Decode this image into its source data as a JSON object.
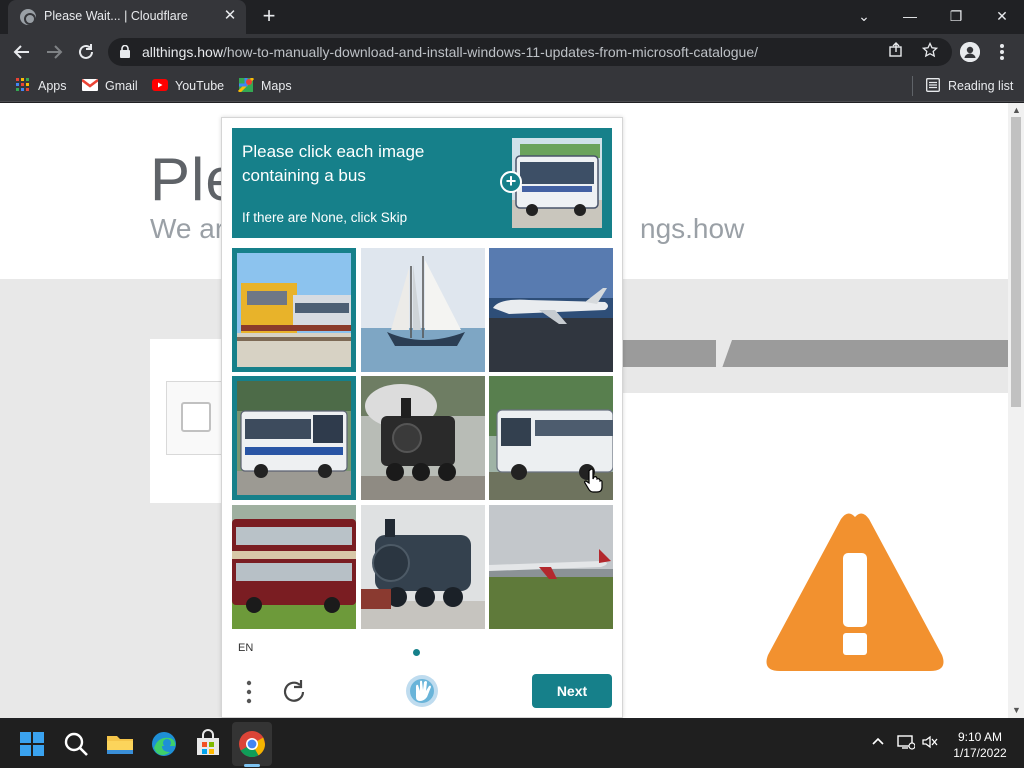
{
  "browser": {
    "tab_title": "Please Wait... | Cloudflare",
    "tab_close": "✕",
    "new_tab": "+",
    "window_controls": {
      "dropdown": "⌄",
      "minimize": "—",
      "restore": "❐",
      "close": "✕"
    },
    "url_domain": "allthings.how",
    "url_path": "/how-to-manually-download-and-install-windows-11-updates-from-microsoft-catalogue/",
    "bookmarks": [
      "Apps",
      "Gmail",
      "YouTube",
      "Maps"
    ],
    "reading_list": "Reading list"
  },
  "page": {
    "title_partial": "Ple",
    "subtitle_partial_left": "We ar",
    "subtitle_partial_right": "ngs.how"
  },
  "captcha": {
    "prompt": "Please click each image containing a bus",
    "skip_hint": "If there are None, click Skip",
    "tiles": [
      {
        "subject": "train",
        "selected": true
      },
      {
        "subject": "sailboat",
        "selected": false
      },
      {
        "subject": "airplane",
        "selected": false
      },
      {
        "subject": "bus",
        "selected": true
      },
      {
        "subject": "steam-locomotive",
        "selected": false
      },
      {
        "subject": "bus",
        "selected": false
      },
      {
        "subject": "double-decker-bus",
        "selected": false
      },
      {
        "subject": "steam-locomotive",
        "selected": false
      },
      {
        "subject": "airplane",
        "selected": false
      }
    ],
    "language": "EN",
    "next_label": "Next",
    "accent_color": "#16808a"
  },
  "taskbar": {
    "time": "9:10 AM",
    "date": "1/17/2022"
  }
}
